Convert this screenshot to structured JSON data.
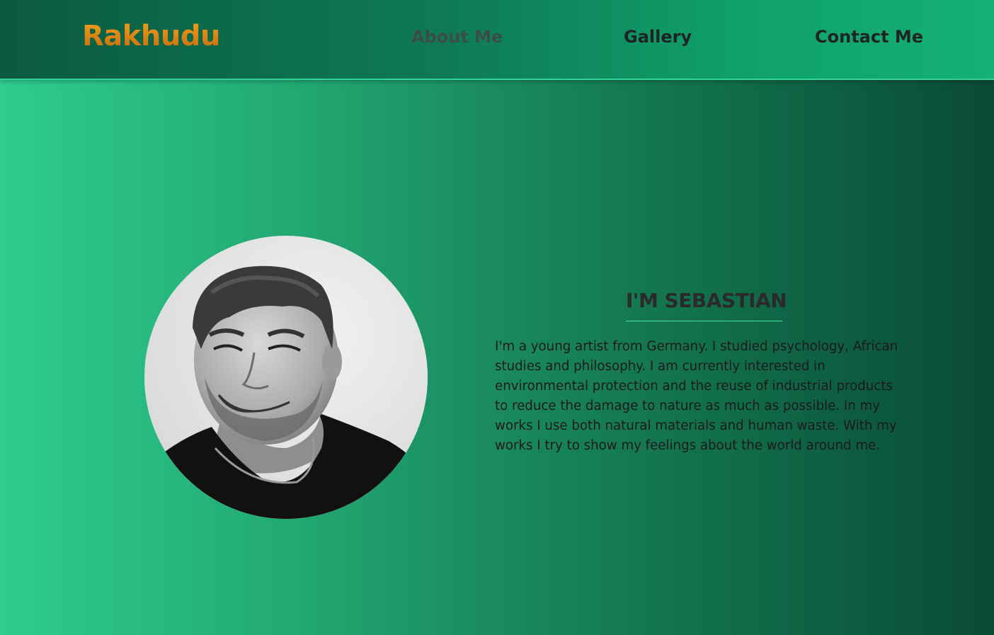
{
  "header": {
    "logo": "Rakhudu",
    "nav": {
      "about": "About Me",
      "gallery": "Gallery",
      "contact": "Contact Me"
    }
  },
  "profile": {
    "photo_icon": "portrait-photo",
    "heading": "I'M SEBASTIAN",
    "bio": "I'm a young artist from Germany. I studied psychology, African studies and philosophy. I am currently interested in environmental protection and the reuse of industrial products to reduce the damage to nature as much as possible. In my works I use both natural materials and human waste. With my works I try to show my feelings about the world around me."
  },
  "colors": {
    "logo_gradient_top": "#f0a11a",
    "logo_gradient_bottom": "#c66a0e",
    "nav_active": "#3c4d45",
    "nav_text": "#1d2422",
    "accent_line": "#4ae0a6"
  }
}
